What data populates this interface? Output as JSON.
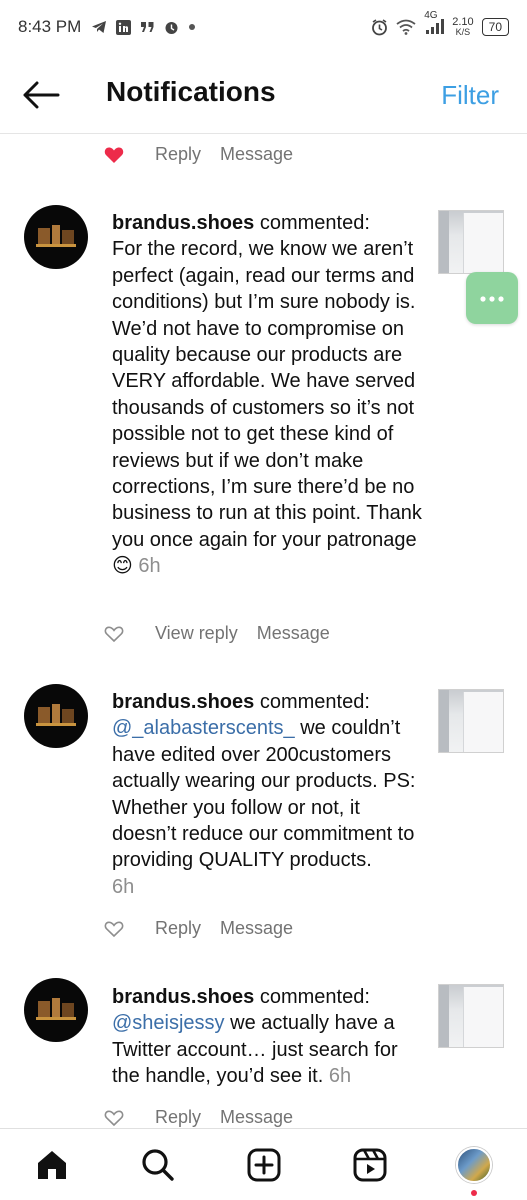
{
  "status_bar": {
    "time": "8:43 PM",
    "network": "4G",
    "net_speed_value": "2.10",
    "net_speed_unit": "K/S",
    "battery": "70"
  },
  "header": {
    "title": "Notifications",
    "filter_label": "Filter"
  },
  "top_actions": {
    "reply": "Reply",
    "message": "Message"
  },
  "notifications": [
    {
      "user": "brandus.shoes",
      "verb": " commented:",
      "mention": "",
      "body": "For the record, we know we aren’t perfect (again, read our terms and conditions) but I’m sure nobody is. We’d not have to compromise on quality because our products are VERY affordable. We have served thousands of customers so it’s not possible not to get these kind of reviews but if we don’t make corrections, I’m sure there’d be no business to run at this point. Thank you once again for your patronage 😊",
      "time": "6h",
      "action_primary": "View reply",
      "action_message": "Message"
    },
    {
      "user": "brandus.shoes",
      "verb": " commented:",
      "mention": "@_alabasterscents_",
      "body": " we couldn’t have edited over 200customers actually wearing our products. PS: Whether you follow or not, it doesn’t reduce our commitment to providing QUALITY products.",
      "time": "6h",
      "action_primary": "Reply",
      "action_message": "Message"
    },
    {
      "user": "brandus.shoes",
      "verb": " commented:",
      "mention": "@sheisjessy",
      "body": " we actually have a Twitter account… just search for the handle, you’d see it.",
      "time": "6h",
      "action_primary": "Reply",
      "action_message": "Message"
    }
  ],
  "bottom_nav": [
    "home-icon",
    "search-icon",
    "create-icon",
    "reels-icon",
    "profile-avatar"
  ],
  "colors": {
    "accent": "#3d9fe3",
    "like": "#ed2b4a",
    "float_button": "#8fd49e"
  }
}
